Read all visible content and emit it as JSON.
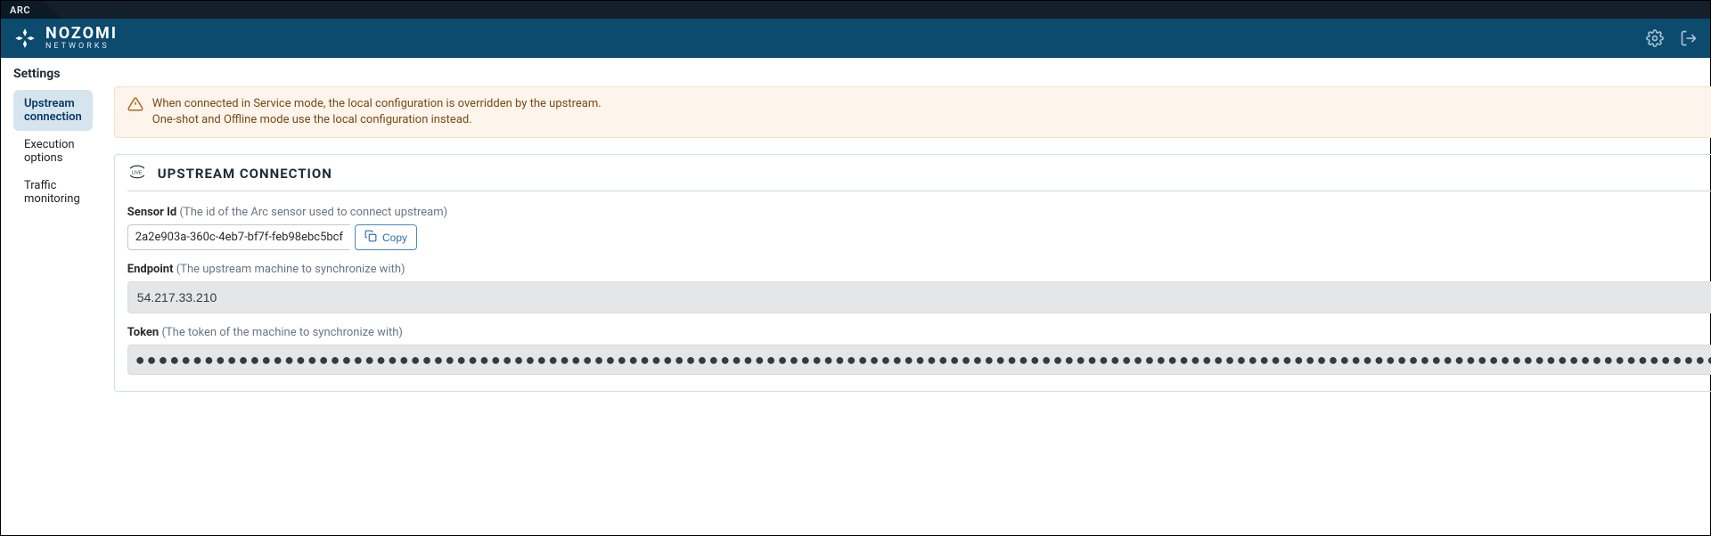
{
  "top_tab": "ARC",
  "brand": {
    "top": "NOZOMI",
    "bottom": "NETWORKS"
  },
  "page_title": "Settings",
  "sidebar": {
    "items": [
      {
        "label": "Upstream connection",
        "active": true
      },
      {
        "label": "Execution options",
        "active": false
      },
      {
        "label": "Traffic monitoring",
        "active": false
      }
    ]
  },
  "alert": {
    "line1": "When connected in Service mode, the local configuration is overridden by the upstream.",
    "line2": "One-shot and Offline mode use the local configuration instead."
  },
  "panel": {
    "title": "UPSTREAM CONNECTION",
    "sensor": {
      "label": "Sensor Id",
      "hint": "(The id of the Arc sensor used to connect upstream)",
      "value": "2a2e903a-360c-4eb7-bf7f-feb98ebc5bcf",
      "copy_label": "Copy"
    },
    "endpoint": {
      "label": "Endpoint",
      "hint": "(The upstream machine to synchronize with)",
      "value": "54.217.33.210"
    },
    "token": {
      "label": "Token",
      "hint": "(The token of the machine to synchronize with)",
      "masked": "●●●●●●●●●●●●●●●●●●●●●●●●●●●●●●●●●●●●●●●●●●●●●●●●●●●●●●●●●●●●●●●●●●●●●●●●●●●●●●●●●●●●●●●●●●●●●●●●●●●●●●●●●●●●●●●●●●●●●●●●●●●●●●●●●●●●●●●●●●●●●●●●●●●●●●●●●●●●●●●●●●●●●●●●●●●●●●●●●●●●●●●●●●●●●●●●●●●●●●●●●●●●●●●●●●●●●●●●●●●●●●●●●●●●●●●●●●●●●●●●"
    }
  }
}
